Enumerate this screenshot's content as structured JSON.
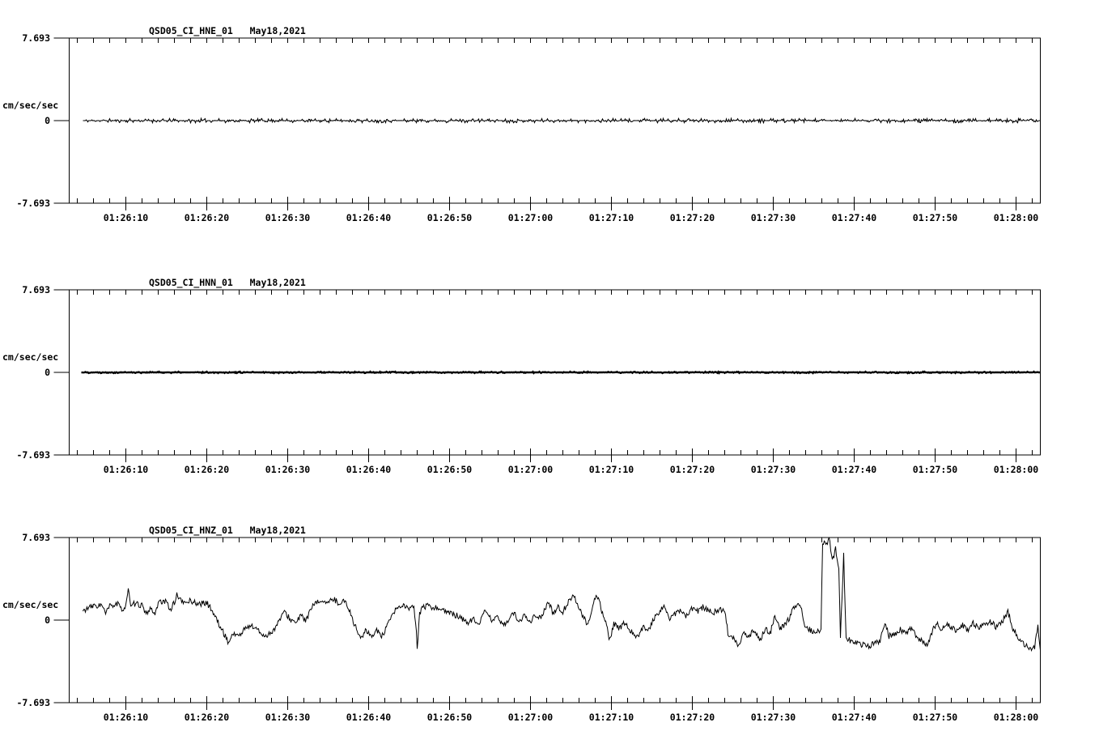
{
  "page": {
    "background_color": "#ffffff",
    "foreground_color": "#000000"
  },
  "chart_data": [
    {
      "type": "line",
      "title": "QSD05_CI_HNE_01   May18,2021",
      "station_channel": "QSD05_CI_HNE_01",
      "date": "May18,2021",
      "ylabel": "cm/sec/sec",
      "y_tick_labels": [
        "7.693",
        "0",
        "-7.693"
      ],
      "ylim": [
        -7.693,
        7.693
      ],
      "x_axis_start": "01:26:03",
      "x_axis_span_seconds": 120,
      "x_minor_tick_seconds": 2,
      "x_tick_labels": [
        "01:26:10",
        "01:26:20",
        "01:26:30",
        "01:26:40",
        "01:26:50",
        "01:27:00",
        "01:27:10",
        "01:27:20",
        "01:27:30",
        "01:27:40",
        "01:27:50",
        "01:28:00"
      ],
      "grid": false,
      "legend": "none",
      "trace_start_s": 1.7,
      "line_width": 1.1,
      "noise_amp": 0.05,
      "noise_shape": "spiky",
      "samples": [
        [
          1.7,
          0
        ],
        [
          120,
          0
        ]
      ]
    },
    {
      "type": "line",
      "title": "QSD05_CI_HNN_01   May18,2021",
      "station_channel": "QSD05_CI_HNN_01",
      "date": "May18,2021",
      "ylabel": "cm/sec/sec",
      "y_tick_labels": [
        "7.693",
        "0",
        "-7.693"
      ],
      "ylim": [
        -7.693,
        7.693
      ],
      "x_axis_start": "01:26:03",
      "x_axis_span_seconds": 120,
      "x_minor_tick_seconds": 2,
      "x_tick_labels": [
        "01:26:10",
        "01:26:20",
        "01:26:30",
        "01:26:40",
        "01:26:50",
        "01:27:00",
        "01:27:10",
        "01:27:20",
        "01:27:30",
        "01:27:40",
        "01:27:50",
        "01:28:00"
      ],
      "grid": false,
      "legend": "none",
      "trace_start_s": 1.5,
      "line_width": 2.4,
      "noise_amp": 0.018,
      "noise_shape": "spiky",
      "samples": [
        [
          1.5,
          0
        ],
        [
          120,
          0
        ]
      ]
    },
    {
      "type": "line",
      "title": "QSD05_CI_HNZ_01   May18,2021",
      "station_channel": "QSD05_CI_HNZ_01",
      "date": "May18,2021",
      "ylabel": "cm/sec/sec",
      "y_tick_labels": [
        "7.693",
        "0",
        "-7.693"
      ],
      "ylim": [
        -7.693,
        7.693
      ],
      "x_axis_start": "01:26:03",
      "x_axis_span_seconds": 120,
      "x_minor_tick_seconds": 2,
      "x_tick_labels": [
        "01:26:10",
        "01:26:20",
        "01:26:30",
        "01:26:40",
        "01:26:50",
        "01:27:00",
        "01:27:10",
        "01:27:20",
        "01:27:30",
        "01:27:40",
        "01:27:50",
        "01:28:00"
      ],
      "grid": false,
      "legend": "none",
      "trace_start_s": 1.7,
      "line_width": 1.0,
      "noise_amp": 0.27,
      "noise_shape": "uniform",
      "samples": [
        [
          1.7,
          0.8
        ],
        [
          2,
          1.0
        ],
        [
          3,
          1.3
        ],
        [
          4,
          1.4
        ],
        [
          4.5,
          0.6
        ],
        [
          5,
          1.3
        ],
        [
          6,
          1.5
        ],
        [
          6.5,
          0.9
        ],
        [
          7,
          1.4
        ],
        [
          7.3,
          3.0
        ],
        [
          7.6,
          1.1
        ],
        [
          8,
          1.5
        ],
        [
          9,
          1.4
        ],
        [
          9.5,
          0.4
        ],
        [
          10,
          1.2
        ],
        [
          10.5,
          0.5
        ],
        [
          11,
          1.6
        ],
        [
          12,
          1.7
        ],
        [
          12.5,
          1.0
        ],
        [
          13,
          1.6
        ],
        [
          13.3,
          2.4
        ],
        [
          14,
          1.6
        ],
        [
          15,
          1.8
        ],
        [
          16,
          1.5
        ],
        [
          17,
          1.6
        ],
        [
          17.5,
          1.1
        ],
        [
          18,
          0.4
        ],
        [
          18.7,
          -0.7
        ],
        [
          19.3,
          -1.5
        ],
        [
          19.7,
          -2.1
        ],
        [
          20.3,
          -1.2
        ],
        [
          21,
          -1.5
        ],
        [
          21.6,
          -0.9
        ],
        [
          22.3,
          -0.5
        ],
        [
          23,
          -0.7
        ],
        [
          23.6,
          -1.2
        ],
        [
          24.3,
          -1.5
        ],
        [
          25,
          -1.1
        ],
        [
          25.6,
          -0.6
        ],
        [
          26.3,
          0.5
        ],
        [
          26.7,
          0.7
        ],
        [
          27.3,
          0.1
        ],
        [
          28,
          -0.3
        ],
        [
          28.6,
          0.4
        ],
        [
          29.3,
          0.0
        ],
        [
          30,
          1.2
        ],
        [
          30.6,
          1.6
        ],
        [
          31.3,
          1.9
        ],
        [
          32,
          1.5
        ],
        [
          32.6,
          2.0
        ],
        [
          33.3,
          1.6
        ],
        [
          34,
          1.8
        ],
        [
          34.6,
          1.0
        ],
        [
          35.3,
          -0.5
        ],
        [
          36,
          -1.7
        ],
        [
          36.6,
          -1.0
        ],
        [
          37.3,
          -1.5
        ],
        [
          38,
          -0.9
        ],
        [
          38.6,
          -1.6
        ],
        [
          39.3,
          -0.6
        ],
        [
          40,
          0.6
        ],
        [
          40.6,
          1.1
        ],
        [
          41.3,
          1.4
        ],
        [
          42,
          1.0
        ],
        [
          42.6,
          1.2
        ],
        [
          42.9,
          -1.0
        ],
        [
          43.0,
          -2.9
        ],
        [
          43.3,
          0.6
        ],
        [
          43.6,
          1.2
        ],
        [
          44.3,
          1.3
        ],
        [
          45,
          1.1
        ],
        [
          45.6,
          1.2
        ],
        [
          46.3,
          0.9
        ],
        [
          47,
          0.6
        ],
        [
          48,
          0.4
        ],
        [
          48.6,
          0.1
        ],
        [
          49.3,
          -0.3
        ],
        [
          50,
          0.2
        ],
        [
          50.6,
          -0.5
        ],
        [
          51.5,
          1.0
        ],
        [
          52.3,
          -0.2
        ],
        [
          53,
          0.3
        ],
        [
          53.6,
          -0.5
        ],
        [
          54.3,
          0.1
        ],
        [
          55,
          0.6
        ],
        [
          55.6,
          -0.2
        ],
        [
          56.3,
          0.4
        ],
        [
          57,
          -0.1
        ],
        [
          57.6,
          0.5
        ],
        [
          58.3,
          0.2
        ],
        [
          59.2,
          1.7
        ],
        [
          59.8,
          0.6
        ],
        [
          60.4,
          1.2
        ],
        [
          61,
          0.8
        ],
        [
          61.6,
          1.6
        ],
        [
          62.2,
          2.3
        ],
        [
          62.8,
          1.6
        ],
        [
          63.5,
          0.3
        ],
        [
          64,
          -0.3
        ],
        [
          64.4,
          0.4
        ],
        [
          64.9,
          1.9
        ],
        [
          65.3,
          2.2
        ],
        [
          65.8,
          0.9
        ],
        [
          66.3,
          -0.3
        ],
        [
          66.8,
          -1.9
        ],
        [
          67.3,
          -0.4
        ],
        [
          68,
          -0.8
        ],
        [
          68.6,
          -0.2
        ],
        [
          69.3,
          -0.9
        ],
        [
          70.2,
          -1.6
        ],
        [
          71,
          -0.6
        ],
        [
          71.6,
          -0.9
        ],
        [
          72.3,
          0.2
        ],
        [
          73,
          0.8
        ],
        [
          73.5,
          1.3
        ],
        [
          74.2,
          0.2
        ],
        [
          74.8,
          0.5
        ],
        [
          75.5,
          0.9
        ],
        [
          76.2,
          0.3
        ],
        [
          77,
          1.1
        ],
        [
          77.6,
          0.8
        ],
        [
          78.3,
          1.2
        ],
        [
          79,
          0.9
        ],
        [
          79.6,
          0.7
        ],
        [
          80.3,
          1.0
        ],
        [
          81,
          0.8
        ],
        [
          81.4,
          -1.2
        ],
        [
          82,
          -1.6
        ],
        [
          82.7,
          -2.3
        ],
        [
          83.3,
          -1.2
        ],
        [
          84,
          -1.6
        ],
        [
          84.6,
          -0.9
        ],
        [
          85.3,
          -1.9
        ],
        [
          86,
          -0.8
        ],
        [
          86.6,
          -1.3
        ],
        [
          87.2,
          0.4
        ],
        [
          87.8,
          -0.9
        ],
        [
          88.4,
          -0.4
        ],
        [
          89,
          0.2
        ],
        [
          89.6,
          1.3
        ],
        [
          90.3,
          1.5
        ],
        [
          91,
          -0.7
        ],
        [
          91.6,
          -0.9
        ],
        [
          92.3,
          -1.1
        ],
        [
          92.9,
          -1.0
        ],
        [
          93.1,
          7.3
        ],
        [
          93.5,
          6.9
        ],
        [
          93.9,
          7.6
        ],
        [
          94.3,
          5.6
        ],
        [
          94.7,
          6.6
        ],
        [
          95.1,
          5.0
        ],
        [
          95.3,
          -1.5
        ],
        [
          95.7,
          6.0
        ],
        [
          96,
          -1.7
        ],
        [
          96.5,
          -1.9
        ],
        [
          97.2,
          -2.1
        ],
        [
          98,
          -2.3
        ],
        [
          98.8,
          -2.4
        ],
        [
          99.5,
          -2.2
        ],
        [
          100.2,
          -1.9
        ],
        [
          100.8,
          -0.3
        ],
        [
          101.3,
          -1.5
        ],
        [
          102,
          -1.3
        ],
        [
          102.7,
          -0.9
        ],
        [
          103.4,
          -1.2
        ],
        [
          104,
          -0.8
        ],
        [
          104.6,
          -1.4
        ],
        [
          105.3,
          -1.9
        ],
        [
          106,
          -2.4
        ],
        [
          106.6,
          -1.1
        ],
        [
          107.2,
          -0.3
        ],
        [
          107.8,
          -1.0
        ],
        [
          108.4,
          -0.3
        ],
        [
          109,
          -0.7
        ],
        [
          109.7,
          -1.1
        ],
        [
          110.4,
          -0.5
        ],
        [
          111,
          -0.9
        ],
        [
          111.7,
          -0.3
        ],
        [
          112.4,
          -0.7
        ],
        [
          113,
          -0.4
        ],
        [
          113.8,
          -0.1
        ],
        [
          114.5,
          -0.6
        ],
        [
          115.2,
          -0.3
        ],
        [
          116,
          0.8
        ],
        [
          116.6,
          -0.9
        ],
        [
          117.3,
          -1.6
        ],
        [
          118,
          -2.3
        ],
        [
          118.7,
          -2.7
        ],
        [
          119.3,
          -2.5
        ],
        [
          119.7,
          -0.7
        ],
        [
          120,
          -2.6
        ]
      ]
    }
  ]
}
